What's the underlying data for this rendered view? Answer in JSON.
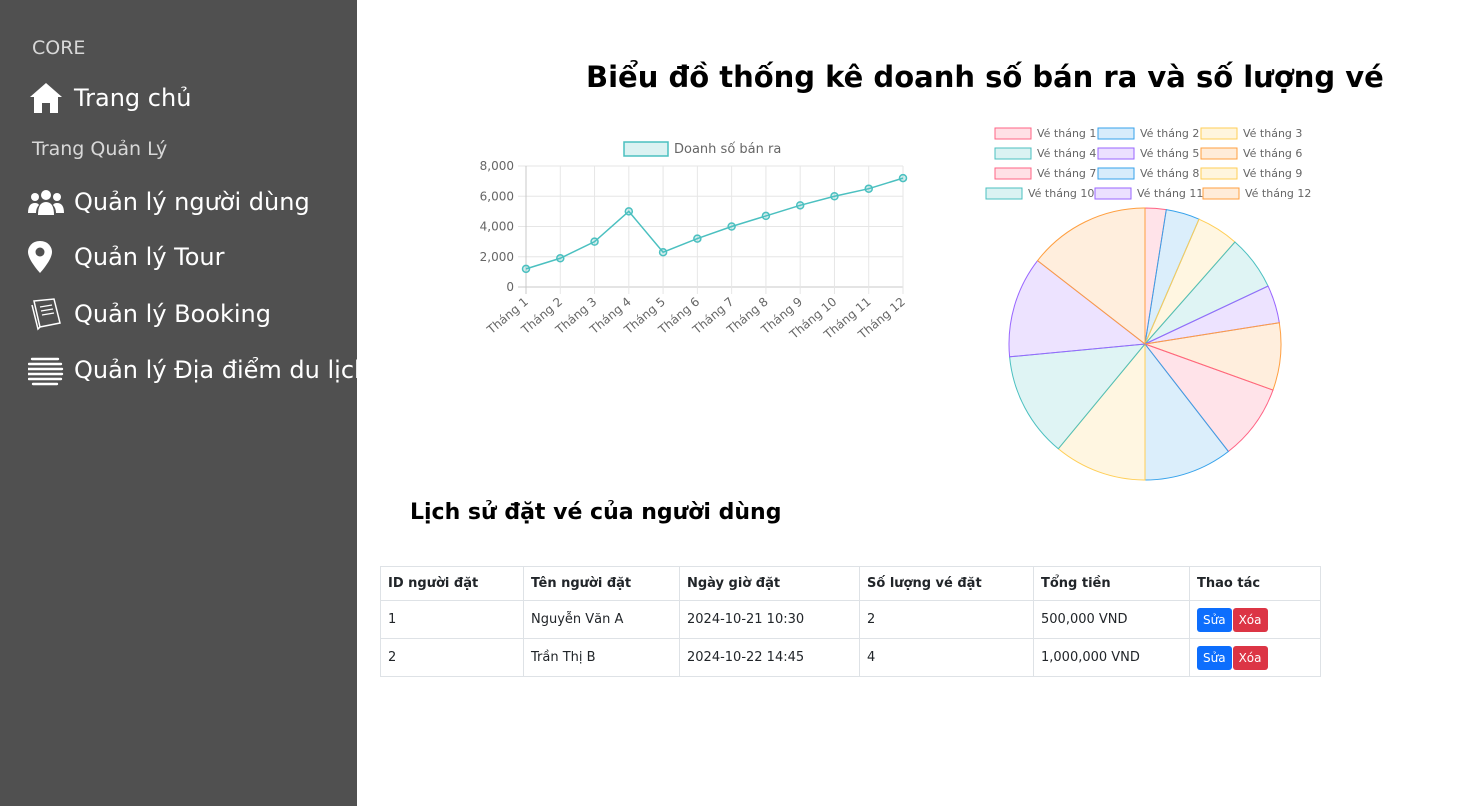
{
  "sidebar": {
    "core_heading": "CORE",
    "manage_heading": "Trang Quản Lý",
    "items": [
      {
        "label": "Trang chủ",
        "icon": "home-icon"
      },
      {
        "label": "Quản lý người dùng",
        "icon": "users-icon"
      },
      {
        "label": "Quản lý Tour",
        "icon": "map-pin-icon"
      },
      {
        "label": "Quản lý Booking",
        "icon": "book-icon"
      },
      {
        "label": "Quản lý Địa điểm du lịch",
        "icon": "globe-icon"
      }
    ]
  },
  "main": {
    "title": "Biểu đồ thống kê doanh số bán ra và số lượng vé",
    "history_title": "Lịch sử đặt vé của người dùng"
  },
  "chart_data": [
    {
      "type": "line",
      "legend": "Doanh số bán ra",
      "categories": [
        "Tháng 1",
        "Tháng 2",
        "Tháng 3",
        "Tháng 4",
        "Tháng 5",
        "Tháng 6",
        "Tháng 7",
        "Tháng 8",
        "Tháng 9",
        "Tháng 10",
        "Tháng 11",
        "Tháng 12"
      ],
      "values": [
        1200,
        1900,
        3000,
        5000,
        2300,
        3200,
        4000,
        4700,
        5400,
        6000,
        6500,
        7200
      ],
      "ylim": [
        0,
        8000
      ],
      "yticks": [
        "0",
        "2,000",
        "4,000",
        "6,000",
        "8,000"
      ],
      "grid": true,
      "color": "#4bc0c0"
    },
    {
      "type": "pie",
      "labels": [
        "Vé tháng 1",
        "Vé tháng 2",
        "Vé tháng 3",
        "Vé tháng 4",
        "Vé tháng 5",
        "Vé tháng 6",
        "Vé tháng 7",
        "Vé tháng 8",
        "Vé tháng 9",
        "Vé tháng 10",
        "Vé tháng 11",
        "Vé tháng 12"
      ],
      "values": [
        2.5,
        4,
        5,
        6.5,
        4.5,
        8,
        9,
        10.5,
        11,
        12.5,
        12,
        14.5
      ],
      "colors": [
        "#ff6384",
        "#36a2eb",
        "#ffce56",
        "#4bc0c0",
        "#9966ff",
        "#ff9f40",
        "#ff6384",
        "#36a2eb",
        "#ffce56",
        "#4bc0c0",
        "#9966ff",
        "#ff9f40"
      ],
      "legend_position": "top"
    }
  ],
  "table": {
    "headers": [
      "ID người đặt",
      "Tên người đặt",
      "Ngày giờ đặt",
      "Số lượng vé đặt",
      "Tổng tiền",
      "Thao tác"
    ],
    "rows": [
      [
        "1",
        "Nguyễn Văn A",
        "2024-10-21 10:30",
        "2",
        "500,000 VND"
      ],
      [
        "2",
        "Trần Thị B",
        "2024-10-22 14:45",
        "4",
        "1,000,000 VND"
      ]
    ],
    "edit_label": "Sửa",
    "delete_label": "Xóa"
  }
}
